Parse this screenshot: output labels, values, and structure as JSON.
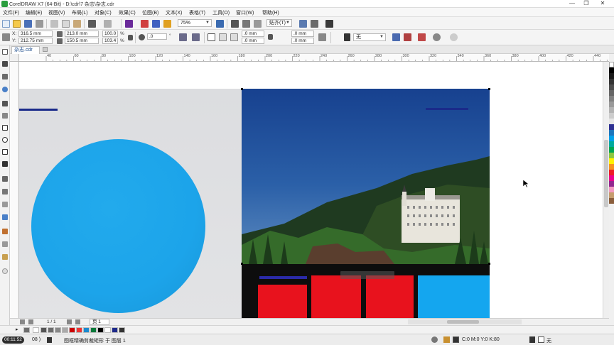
{
  "window": {
    "title": "CorelDRAW X7 (64-Bit) - D:\\cdr\\7 杂志\\杂志.cdr",
    "minimize": "—",
    "maximize": "❐",
    "close": "✕"
  },
  "menu": [
    "文件(F)",
    "编辑(E)",
    "视图(V)",
    "布局(L)",
    "对象(C)",
    "效果(C)",
    "位图(B)",
    "文本(X)",
    "表格(T)",
    "工具(O)",
    "窗口(W)",
    "帮助(H)"
  ],
  "toolbar": {
    "zoom": "75%",
    "snap_label": "贴齐(T)"
  },
  "property_bar": {
    "x_label": "X:",
    "x_value": "316.5 mm",
    "y_label": "Y:",
    "y_value": "212.75 mm",
    "width_value": "213.0 mm",
    "height_value": "150.5 mm",
    "scale_w": "100.0",
    "scale_h": "103.4",
    "pct1": "%",
    "pct2": "%",
    "angle": ".0",
    "deg": "°",
    "corner_tl": ".0 mm",
    "corner_bl": ".0 mm",
    "corner_tr": ".0 mm",
    "corner_br": ".0 mm",
    "outline": "无"
  },
  "document_tab": "杂志.cdr",
  "ruler_ticks": [
    "40",
    "60",
    "80",
    "100",
    "120",
    "140",
    "160",
    "180",
    "200",
    "220",
    "240",
    "260",
    "280",
    "300",
    "320",
    "340",
    "360",
    "380",
    "400",
    "420",
    "440",
    "460",
    "480"
  ],
  "page_nav": {
    "counter": "1 / 1",
    "page_tab": "页 1"
  },
  "status": {
    "timer": "00:11:52",
    "count_fragment": "08 )",
    "selection_info": "图框精确剪裁矩形 于 图层 1",
    "fill_info": "C:0 M:0 Y:0 K:80",
    "outline_info": "无"
  },
  "colors": {
    "accent_blue": "#1a2a8a",
    "circle_blue": "#1ca4ea",
    "brand_red": "#e8121d",
    "sky_top": "#1c4a9a",
    "light_blue_block": "#14a6ef"
  }
}
